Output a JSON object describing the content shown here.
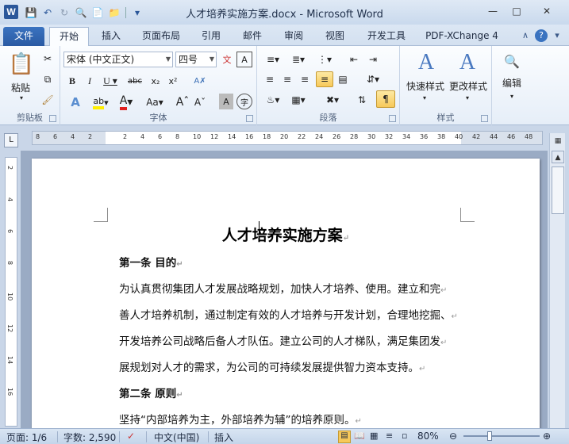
{
  "window": {
    "title": "人才培养实施方案.docx  -  Microsoft Word",
    "app_icon": "W"
  },
  "tabs": [
    {
      "label": "文件"
    },
    {
      "label": "开始"
    },
    {
      "label": "插入"
    },
    {
      "label": "页面布局"
    },
    {
      "label": "引用"
    },
    {
      "label": "邮件"
    },
    {
      "label": "审阅"
    },
    {
      "label": "视图"
    },
    {
      "label": "开发工具"
    },
    {
      "label": "PDF-XChange 4"
    }
  ],
  "ribbon": {
    "clipboard": {
      "paste": "粘贴",
      "group": "剪贴板"
    },
    "font": {
      "name": "宋体 (中文正文)",
      "size": "四号",
      "group": "字体"
    },
    "paragraph": {
      "group": "段落"
    },
    "styles": {
      "quick": "快速样式",
      "change": "更改样式",
      "group": "样式"
    },
    "editing": {
      "label": "编辑"
    }
  },
  "ruler_ticks": [
    "8",
    "6",
    "4",
    "2",
    "",
    "2",
    "4",
    "6",
    "8",
    "10",
    "12",
    "14",
    "16",
    "18",
    "20",
    "22",
    "24",
    "26",
    "28",
    "30",
    "32",
    "34",
    "36",
    "38",
    "40",
    "42",
    "44",
    "46",
    "48"
  ],
  "vruler_ticks": [
    "2",
    "4",
    "6",
    "8",
    "10",
    "12",
    "14",
    "16"
  ],
  "document": {
    "title": "人才培养实施方案",
    "paragraphs": [
      {
        "text": "第一条 目的",
        "heading": true
      },
      {
        "text": "为认真贯彻集团人才发展战略规划，加快人才培养、使用。建立和完",
        "heading": false
      },
      {
        "text": "善人才培养机制，通过制定有效的人才培养与开发计划，合理地挖掘、",
        "heading": false
      },
      {
        "text": "开发培养公司战略后备人才队伍。建立公司的人才梯队，满足集团发",
        "heading": false
      },
      {
        "text": "展规划对人才的需求，为公司的可持续发展提供智力资本支持。",
        "heading": false
      },
      {
        "text": "第二条 原则",
        "heading": true
      },
      {
        "text": "坚持“内部培养为主，外部培养为辅”的培养原则。",
        "heading": false
      }
    ]
  },
  "status": {
    "page": "页面: 1/6",
    "words": "字数: 2,590",
    "language": "中文(中国)",
    "mode": "插入",
    "zoom": "80%"
  }
}
